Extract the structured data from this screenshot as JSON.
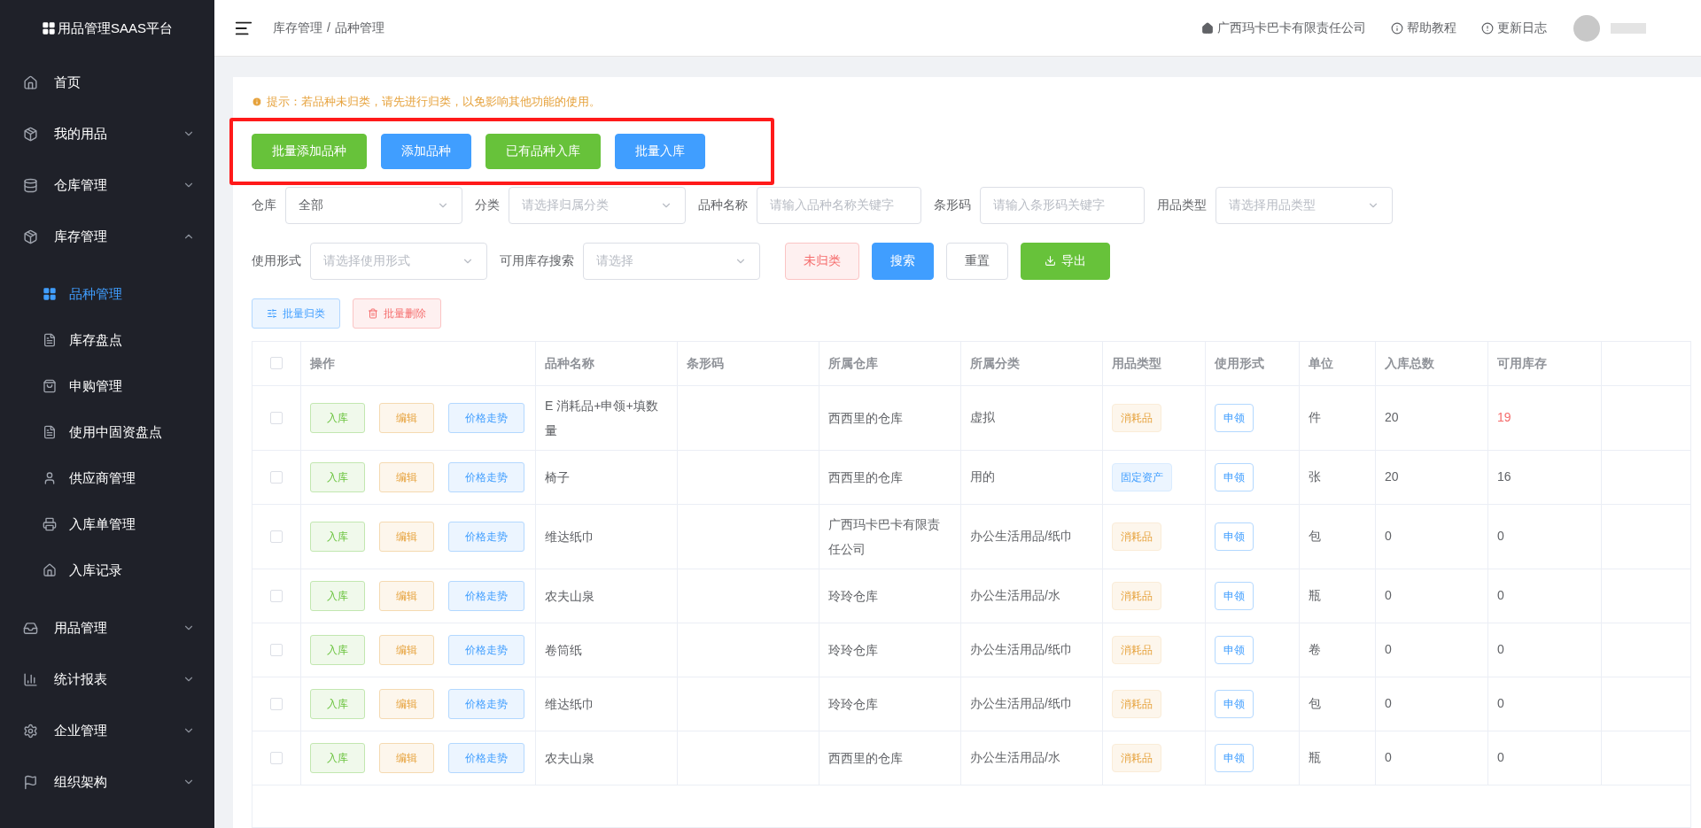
{
  "sidebar": {
    "logo": "用品管理SAAS平台",
    "items": [
      {
        "label": "首页"
      },
      {
        "label": "我的用品",
        "expanded": false
      },
      {
        "label": "仓库管理",
        "expanded": false
      },
      {
        "label": "库存管理",
        "expanded": true,
        "children": [
          {
            "label": "品种管理",
            "selected": true
          },
          {
            "label": "库存盘点",
            "selected": false
          },
          {
            "label": "申购管理",
            "selected": false
          },
          {
            "label": "使用中固资盘点",
            "selected": false
          },
          {
            "label": "供应商管理",
            "selected": false
          },
          {
            "label": "入库单管理",
            "selected": false
          },
          {
            "label": "入库记录",
            "selected": false
          }
        ]
      },
      {
        "label": "用品管理",
        "expanded": false
      },
      {
        "label": "统计报表",
        "expanded": false
      },
      {
        "label": "企业管理",
        "expanded": false
      },
      {
        "label": "组织架构",
        "expanded": false
      }
    ]
  },
  "header": {
    "breadcrumb": [
      "库存管理",
      "品种管理"
    ],
    "breadcrumb_separator": "/",
    "company": "广西玛卡巴卡有限责任公司",
    "help": "帮助教程",
    "changelog": "更新日志"
  },
  "notice": "提示：若品种未归类，请先进行归类，以免影响其他功能的使用。",
  "action_buttons": [
    {
      "label": "批量添加品种",
      "kind": "success"
    },
    {
      "label": "添加品种",
      "kind": "primary"
    },
    {
      "label": "已有品种入库",
      "kind": "success"
    },
    {
      "label": "批量入库",
      "kind": "primary"
    }
  ],
  "filters": [
    [
      {
        "label": "仓库",
        "kind": "select",
        "value": "全部"
      },
      {
        "label": "分类",
        "kind": "select",
        "placeholder": "请选择归属分类"
      },
      {
        "label": "品种名称",
        "kind": "input",
        "placeholder": "请输入品种名称关键字"
      },
      {
        "label": "条形码",
        "kind": "input",
        "placeholder": "请输入条形码关键字"
      },
      {
        "label": "用品类型",
        "kind": "select",
        "placeholder": "请选择用品类型"
      }
    ],
    [
      {
        "label": "使用形式",
        "kind": "select",
        "placeholder": "请选择使用形式"
      },
      {
        "label": "可用库存搜索",
        "kind": "select",
        "placeholder": "请选择"
      }
    ]
  ],
  "filter_buttons": [
    {
      "label": "未归类",
      "kind": "danger"
    },
    {
      "label": "搜索",
      "kind": "primary"
    },
    {
      "label": "重置",
      "kind": "default"
    },
    {
      "label": "导出",
      "kind": "export"
    }
  ],
  "batch_buttons": [
    {
      "label": "批量归类",
      "kind": "classify"
    },
    {
      "label": "批量删除",
      "kind": "delete"
    }
  ],
  "table": {
    "all_checked": false,
    "columns": [
      "操作",
      "品种名称",
      "条形码",
      "所属仓库",
      "所属分类",
      "用品类型",
      "使用形式",
      "单位",
      "入库总数",
      "可用库存"
    ],
    "rows": [
      {
        "checked": false,
        "actions": [
          "入库",
          "编辑",
          "价格走势"
        ],
        "name": "E 消耗品+申领+填数量",
        "barcode": "",
        "warehouse": "西西里的仓库",
        "category": "虚拟",
        "type": {
          "text": "消耗品",
          "kind": "consumable"
        },
        "usage": "申领",
        "unit": "件",
        "total": "20",
        "available": "19",
        "low_stock": true
      },
      {
        "checked": false,
        "actions": [
          "入库",
          "编辑",
          "价格走势"
        ],
        "name": "椅子",
        "barcode": "",
        "warehouse": "西西里的仓库",
        "category": "用的",
        "type": {
          "text": "固定资产",
          "kind": "asset"
        },
        "usage": "申领",
        "unit": "张",
        "total": "20",
        "available": "16",
        "low_stock": false
      },
      {
        "checked": false,
        "actions": [
          "入库",
          "编辑",
          "价格走势"
        ],
        "name": "维达纸巾",
        "barcode": "",
        "warehouse": "广西玛卡巴卡有限责任公司",
        "category": "办公生活用品/纸巾",
        "type": {
          "text": "消耗品",
          "kind": "consumable"
        },
        "usage": "申领",
        "unit": "包",
        "total": "0",
        "available": "0",
        "low_stock": false
      },
      {
        "checked": false,
        "actions": [
          "入库",
          "编辑",
          "价格走势"
        ],
        "name": "农夫山泉",
        "barcode": "",
        "warehouse": "玲玲仓库",
        "category": "办公生活用品/水",
        "type": {
          "text": "消耗品",
          "kind": "consumable"
        },
        "usage": "申领",
        "unit": "瓶",
        "total": "0",
        "available": "0",
        "low_stock": false
      },
      {
        "checked": false,
        "actions": [
          "入库",
          "编辑",
          "价格走势"
        ],
        "name": "卷筒纸",
        "barcode": "",
        "warehouse": "玲玲仓库",
        "category": "办公生活用品/纸巾",
        "type": {
          "text": "消耗品",
          "kind": "consumable"
        },
        "usage": "申领",
        "unit": "卷",
        "total": "0",
        "available": "0",
        "low_stock": false
      },
      {
        "checked": false,
        "actions": [
          "入库",
          "编辑",
          "价格走势"
        ],
        "name": "维达纸巾",
        "barcode": "",
        "warehouse": "玲玲仓库",
        "category": "办公生活用品/纸巾",
        "type": {
          "text": "消耗品",
          "kind": "consumable"
        },
        "usage": "申领",
        "unit": "包",
        "total": "0",
        "available": "0",
        "low_stock": false
      },
      {
        "checked": false,
        "actions": [
          "入库",
          "编辑",
          "价格走势"
        ],
        "name": "农夫山泉",
        "barcode": "",
        "warehouse": "西西里的仓库",
        "category": "办公生活用品/水",
        "type": {
          "text": "消耗品",
          "kind": "consumable"
        },
        "usage": "申领",
        "unit": "瓶",
        "total": "0",
        "available": "0",
        "low_stock": false
      }
    ]
  }
}
